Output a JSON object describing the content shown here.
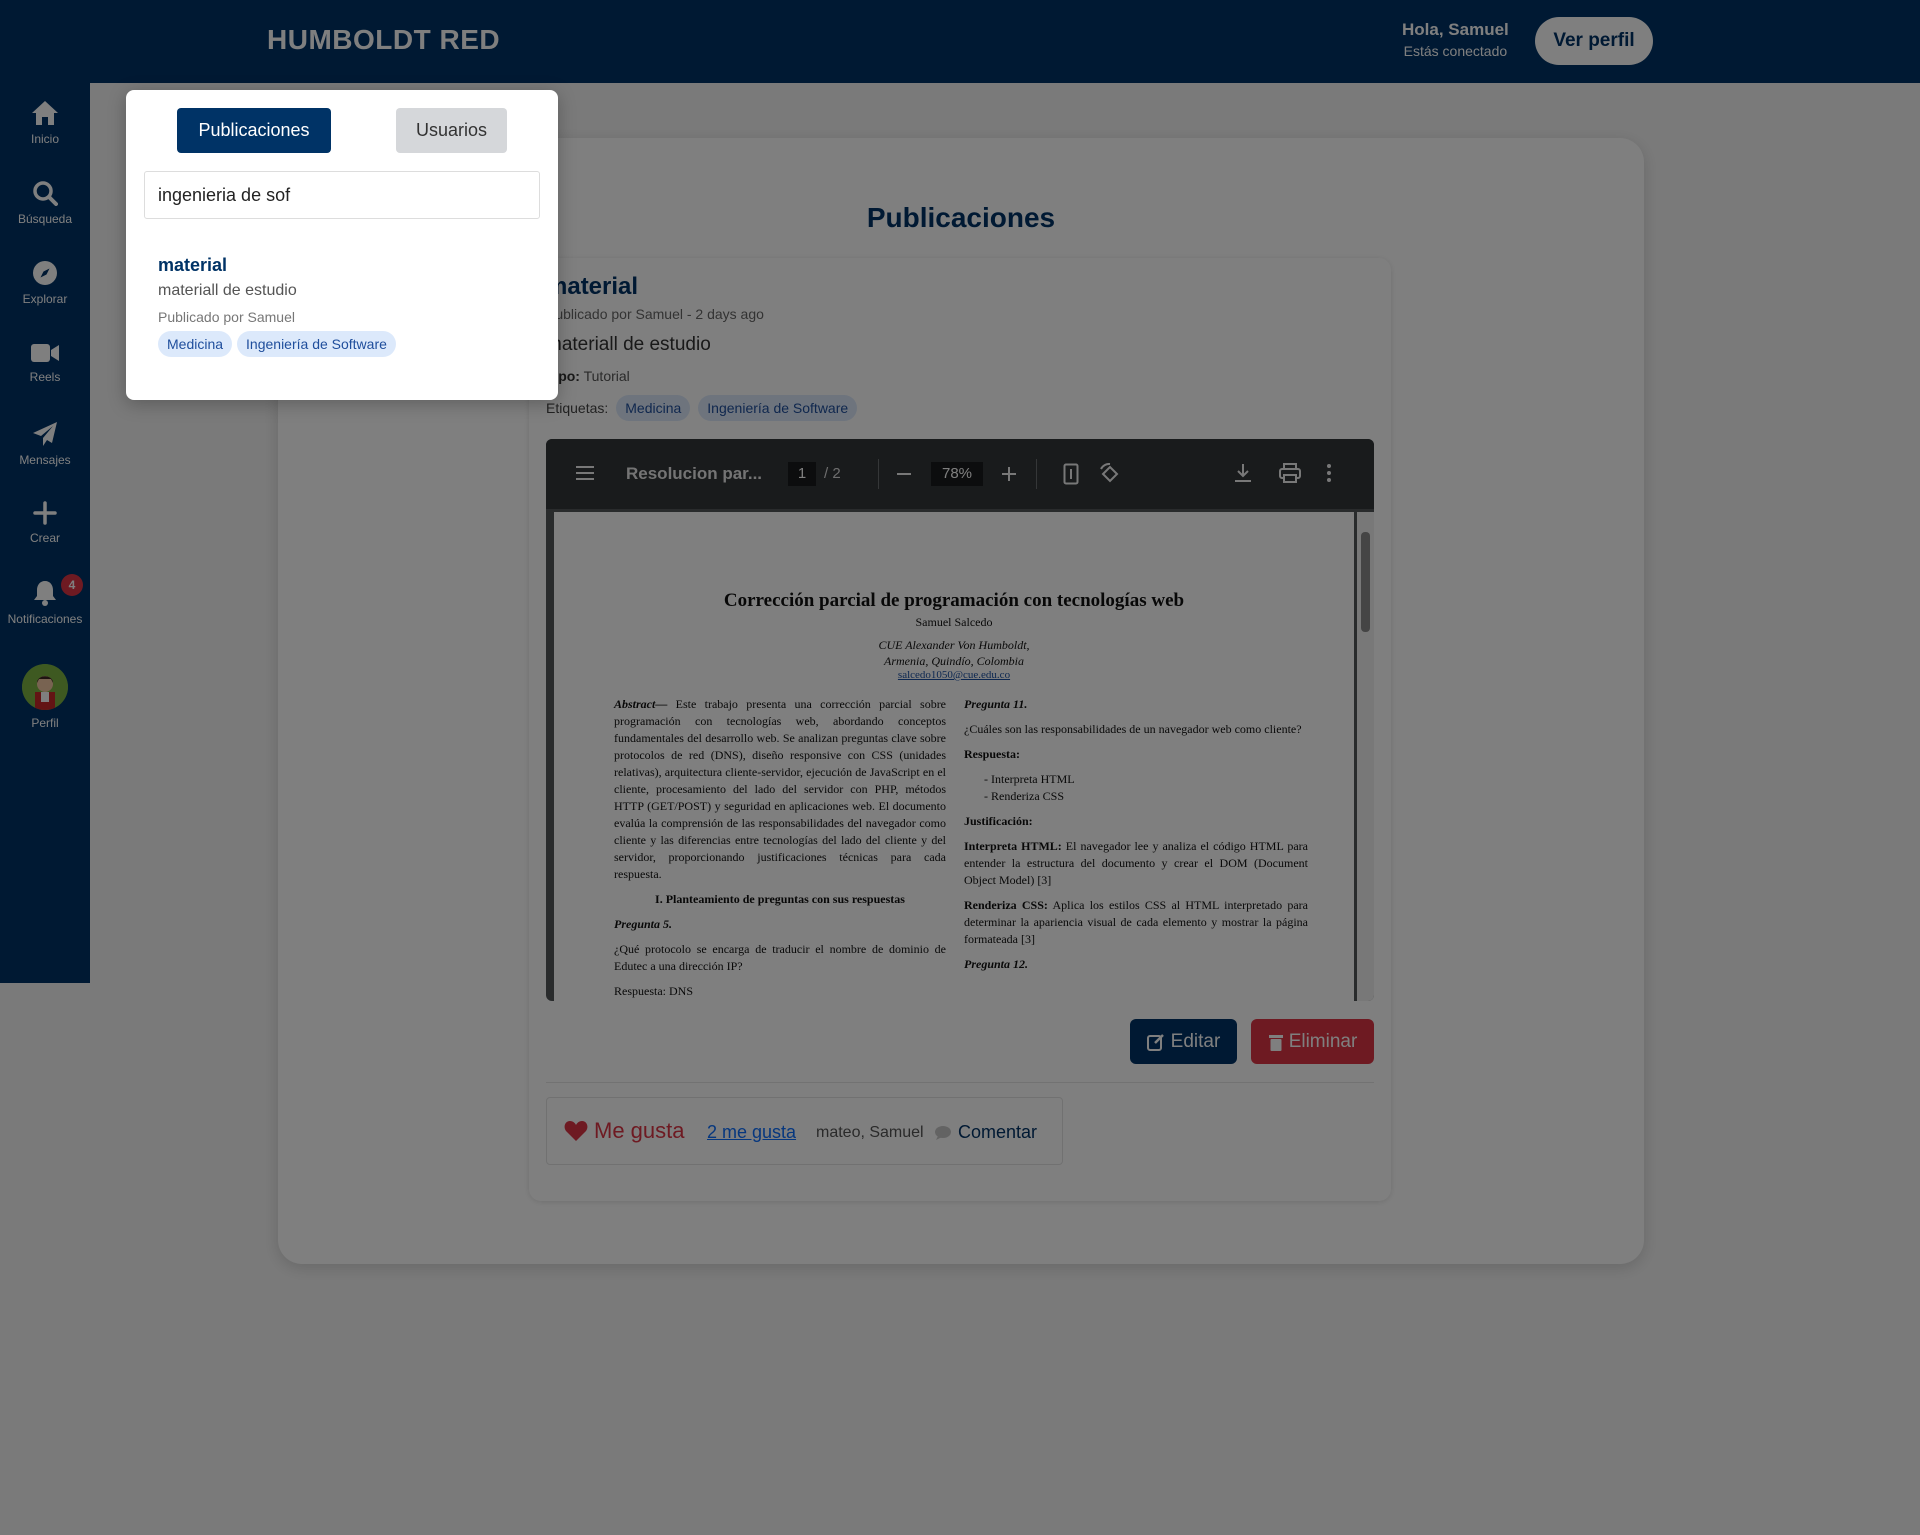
{
  "header": {
    "brand": "HUMBOLDT RED",
    "greeting": "Hola, Samuel",
    "status": "Estás conectado",
    "profile_button": "Ver perfil"
  },
  "sidebar": {
    "items": [
      {
        "label": "Inicio",
        "icon": "home-icon"
      },
      {
        "label": "Búsqueda",
        "icon": "search-icon"
      },
      {
        "label": "Explorar",
        "icon": "compass-icon"
      },
      {
        "label": "Reels",
        "icon": "video-icon"
      },
      {
        "label": "Mensajes",
        "icon": "send-icon"
      },
      {
        "label": "Crear",
        "icon": "plus-icon"
      },
      {
        "label": "Notificaciones",
        "icon": "bell-icon",
        "badge": "4"
      },
      {
        "label": "Perfil",
        "icon": "avatar"
      }
    ]
  },
  "main": {
    "page_title": "Publicaciones",
    "post": {
      "title": "material",
      "meta": "Publicado por Samuel - 2 days ago",
      "description": "materiall de estudio",
      "type_label": "Tipo:",
      "type_value": "Tutorial",
      "tags_label": "Etiquetas:",
      "tags": [
        "Medicina",
        "Ingeniería de Software"
      ]
    },
    "pdf": {
      "file_name": "Resolucion par...",
      "page": "1",
      "page_total": "/  2",
      "zoom": "78%",
      "doc_title": "Corrección parcial de programación con tecnologías web",
      "doc_author": "Samuel Salcedo",
      "doc_aff1": "CUE Alexander Von Humboldt,",
      "doc_aff2": "Armenia, Quindío, Colombia",
      "doc_email": "salcedo1050@cue.edu.co",
      "abstract_label": "Abstract—",
      "abstract": "Este trabajo presenta una corrección parcial sobre programación con tecnologías web, abordando conceptos fundamentales del desarrollo web. Se analizan preguntas clave sobre protocolos de red (DNS), diseño responsive con CSS (unidades relativas), arquitectura cliente-servidor, ejecución de JavaScript en el cliente, procesamiento del lado del servidor con PHP, métodos HTTP (GET/POST) y seguridad en aplicaciones web. El documento evalúa la comprensión de las responsabilidades del navegador como cliente y las diferencias entre tecnologías del lado del cliente y del servidor, proporcionando justificaciones técnicas para cada respuesta.",
      "section1": "I.      Planteamiento de preguntas con sus respuestas",
      "q5_label": "Pregunta 5.",
      "q5_text": "¿Qué protocolo se encarga de traducir el nombre de dominio de Edutec a una dirección IP?",
      "q5_answer": "Respuesta: DNS",
      "q11_label": "Pregunta 11.",
      "q11_text": "¿Cuáles son las responsabilidades de un navegador web como cliente?",
      "answer_label": "Respuesta:",
      "answer_items": [
        "Interpreta HTML",
        "Renderiza CSS"
      ],
      "justification_label": "Justificación:",
      "just1_label": "Interpreta HTML:",
      "just1_text": "El navegador lee y analiza el código HTML para entender la estructura del documento y crear el DOM (Document Object Model) [3]",
      "just2_label": "Renderiza CSS:",
      "just2_text": "Aplica los estilos CSS al HTML interpretado para determinar la apariencia visual de cada elemento y mostrar la página formateada  [3]",
      "q12_label": "Pregunta 12."
    },
    "actions": {
      "edit": "Editar",
      "delete": "Eliminar"
    },
    "reactions": {
      "like": "Me gusta",
      "likes_count": "2 me gusta",
      "likers": "mateo, Samuel",
      "comment": "Comentar"
    }
  },
  "search_panel": {
    "tab_posts": "Publicaciones",
    "tab_users": "Usuarios",
    "query": "ingenieria de sof",
    "result": {
      "title": "material",
      "description": "materiall de estudio",
      "by": "Publicado por Samuel",
      "tags": [
        "Medicina",
        "Ingeniería de Software"
      ]
    }
  },
  "colors": {
    "primary": "#003366",
    "danger": "#dc3545",
    "tag_bg": "#dce9fb",
    "tag_text": "#1f4e9c"
  }
}
